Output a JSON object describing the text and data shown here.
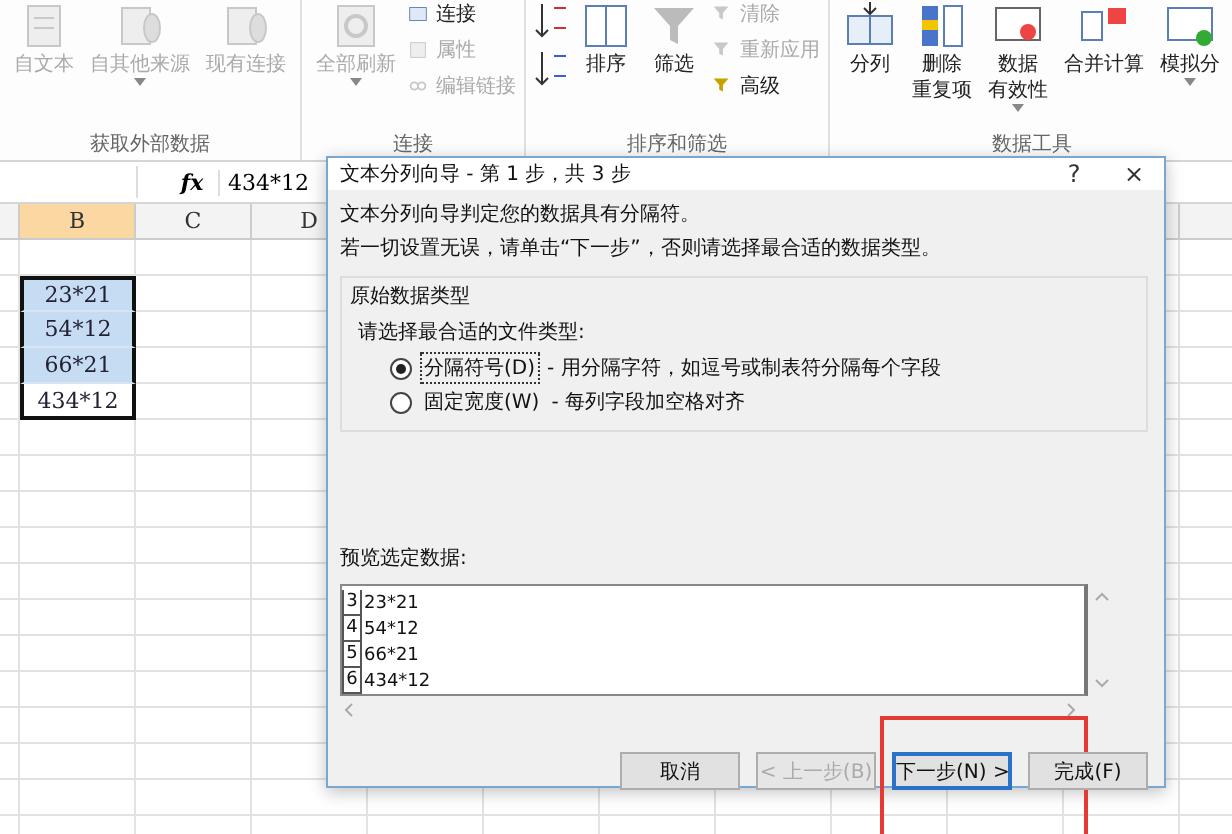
{
  "ribbon": {
    "groups": [
      {
        "label": "获取外部数据",
        "items": [
          {
            "kind": "big",
            "lines": [
              "自文本"
            ],
            "disabled": true,
            "dropdown": false
          },
          {
            "kind": "big",
            "lines": [
              "自其他来源"
            ],
            "disabled": true,
            "dropdown": true
          },
          {
            "kind": "big",
            "lines": [
              "现有连接"
            ],
            "disabled": true,
            "dropdown": false
          }
        ]
      },
      {
        "label": "连接",
        "items": [
          {
            "kind": "big",
            "lines": [
              "全部刷新"
            ],
            "disabled": true,
            "dropdown": true
          },
          {
            "kind": "stack",
            "rows": [
              {
                "label": "连接",
                "disabled": false
              },
              {
                "label": "属性",
                "disabled": true
              },
              {
                "label": "编辑链接",
                "disabled": true
              }
            ]
          }
        ]
      },
      {
        "label": "排序和筛选",
        "items": [
          {
            "kind": "sortpair"
          },
          {
            "kind": "big",
            "lines": [
              "排序"
            ],
            "disabled": false,
            "dropdown": false
          },
          {
            "kind": "big",
            "lines": [
              "筛选"
            ],
            "disabled": false,
            "dropdown": false
          },
          {
            "kind": "stack",
            "rows": [
              {
                "label": "清除",
                "disabled": true
              },
              {
                "label": "重新应用",
                "disabled": true
              },
              {
                "label": "高级",
                "disabled": false
              }
            ]
          }
        ]
      },
      {
        "label": "数据工具",
        "items": [
          {
            "kind": "big",
            "lines": [
              "分列"
            ],
            "disabled": false,
            "dropdown": false
          },
          {
            "kind": "big",
            "lines": [
              "删除",
              "重复项"
            ],
            "disabled": false,
            "dropdown": false
          },
          {
            "kind": "big",
            "lines": [
              "数据",
              "有效性"
            ],
            "disabled": false,
            "dropdown": true
          },
          {
            "kind": "big",
            "lines": [
              "合并计算"
            ],
            "disabled": false,
            "dropdown": false
          },
          {
            "kind": "big",
            "lines": [
              "模拟分"
            ],
            "disabled": false,
            "dropdown": true
          }
        ]
      }
    ]
  },
  "formula_bar": {
    "value": "434*12",
    "fx": "fx"
  },
  "sheet": {
    "columns": [
      {
        "label": "B",
        "selected": true
      },
      {
        "label": "C",
        "selected": false
      },
      {
        "label": "D",
        "selected": false
      }
    ],
    "cells": [
      {
        "value": "23*21",
        "selected": true
      },
      {
        "value": "54*12",
        "selected": true
      },
      {
        "value": "66*21",
        "selected": true
      },
      {
        "value": "434*12",
        "selected": false
      }
    ]
  },
  "dialog": {
    "title": "文本分列向导 - 第 1 步，共 3 步",
    "help": "?",
    "close": "×",
    "intro": [
      "文本分列向导判定您的数据具有分隔符。",
      "若一切设置无误，请单击“下一步”，否则请选择最合适的数据类型。"
    ],
    "group_title": "原始数据类型",
    "prompt": "请选择最合适的文件类型:",
    "options": [
      {
        "label": "分隔符号(D)",
        "description": "- 用分隔字符，如逗号或制表符分隔每个字段",
        "selected": true
      },
      {
        "label": "固定宽度(W)",
        "description": "- 每列字段加空格对齐",
        "selected": false
      }
    ],
    "preview_label": "预览选定数据:",
    "preview_rows": [
      {
        "number": "3",
        "text": "23*21"
      },
      {
        "number": "4",
        "text": "54*12"
      },
      {
        "number": "5",
        "text": "66*21"
      },
      {
        "number": "6",
        "text": "434*12"
      }
    ],
    "buttons": [
      {
        "label": "取消",
        "disabled": false,
        "default": false,
        "highlighted": false
      },
      {
        "label": "< 上一步(B)",
        "disabled": true,
        "default": false,
        "highlighted": false
      },
      {
        "label": "下一步(N) >",
        "disabled": false,
        "default": true,
        "highlighted": true
      },
      {
        "label": "完成(F)",
        "disabled": false,
        "default": false,
        "highlighted": false
      }
    ]
  }
}
